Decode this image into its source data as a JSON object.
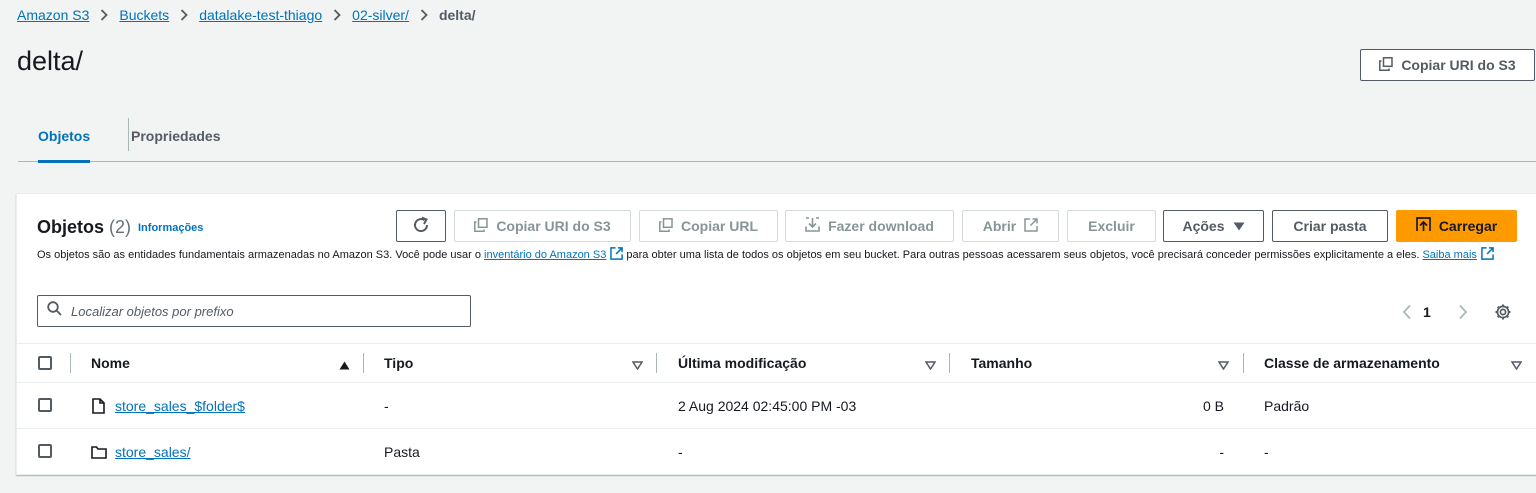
{
  "breadcrumb": {
    "items": [
      "Amazon S3",
      "Buckets",
      "datalake-test-thiago",
      "02-silver/"
    ],
    "current": "delta/"
  },
  "page": {
    "title": "delta/",
    "copy_uri_label": "Copiar URI do S3"
  },
  "tabs": [
    {
      "label": "Objetos",
      "active": true
    },
    {
      "label": "Propriedades",
      "active": false
    }
  ],
  "objects_panel": {
    "title": "Objetos",
    "count": "(2)",
    "info_link": "Informações",
    "description_part1": "Os objetos são as entidades fundamentais armazenadas no Amazon S3. Você pode usar o ",
    "description_link1": "inventário do Amazon S3",
    "description_part2": " para obter uma lista de todos os objetos em seu bucket. Para outras pessoas acessarem seus objetos, você precisará conceder permissões explicitamente a eles. ",
    "description_link2": "Saiba mais",
    "toolbar": {
      "copy_uri": "Copiar URI do S3",
      "copy_url": "Copiar URL",
      "download": "Fazer download",
      "open": "Abrir",
      "delete": "Excluir",
      "actions": "Ações",
      "create_folder": "Criar pasta",
      "upload": "Carregar"
    },
    "search_placeholder": "Localizar objetos por prefixo",
    "pagination": {
      "current_page": "1"
    }
  },
  "table": {
    "columns": [
      "Nome",
      "Tipo",
      "Última modificação",
      "Tamanho",
      "Classe de armazenamento"
    ],
    "rows": [
      {
        "icon": "file-icon",
        "name": "store_sales_$folder$",
        "type": "-",
        "modified": "2 Aug 2024 02:45:00 PM -03",
        "size": "0 B",
        "storage_class": "Padrão"
      },
      {
        "icon": "folder-icon",
        "name": "store_sales/",
        "type": "Pasta",
        "modified": "-",
        "size": "-",
        "storage_class": "-"
      }
    ]
  },
  "colors": {
    "link": "#0073bb",
    "primary_button": "#ff9900",
    "disabled_text": "#879596",
    "page_background": "#f2f3f3"
  }
}
